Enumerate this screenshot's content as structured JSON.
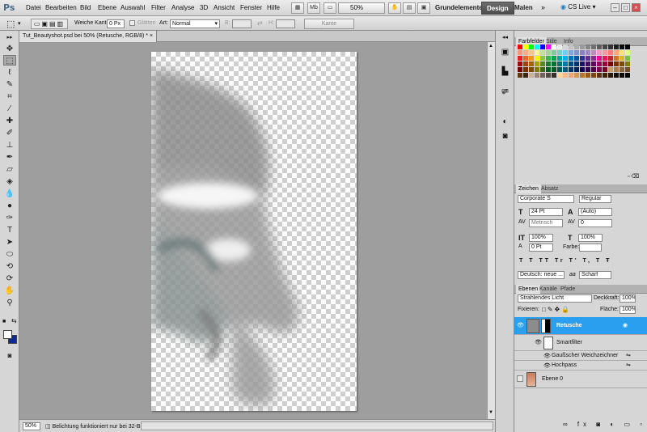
{
  "app": {
    "logo": "Ps"
  },
  "menu": [
    "Datei",
    "Bearbeiten",
    "Bild",
    "Ebene",
    "Auswahl",
    "Filter",
    "Analyse",
    "3D",
    "Ansicht",
    "Fenster",
    "Hilfe"
  ],
  "appbar": {
    "zoom": "50%",
    "workspaces": [
      "Grundelemente",
      "Design",
      "Malen"
    ],
    "cs_live": "CS Live",
    "mb_label": "Mb"
  },
  "options": {
    "soft_edge_label": "Weiche Kante:",
    "soft_edge_value": "0 Px",
    "antialias_label": "Glätten",
    "style_label": "Art:",
    "style_value": "Normal",
    "width_label": "B:",
    "height_label": "H:",
    "refine_button": "Kante verbessern..."
  },
  "document": {
    "tab_title": "Tut_Beautyshot.psd bei 50% (Retusche, RGB/8) *",
    "zoom": "50%",
    "status": "Belichtung funktioniert nur bei 32-Bit"
  },
  "swatch_panel": {
    "tabs": [
      "Farbfelder",
      "Stile",
      "Info"
    ]
  },
  "swatch_colors": [
    [
      "#ff0000",
      "#ffff00",
      "#00ff00",
      "#00ffff",
      "#0000ff",
      "#ff00ff",
      "#ffffff",
      "#ebebeb",
      "#d6d6d6",
      "#c2c2c2",
      "#adadad",
      "#999999",
      "#858585",
      "#707070",
      "#5c5c5c",
      "#474747",
      "#333333",
      "#1f1f1f",
      "#0a0a0a",
      "#000000"
    ],
    [
      "#f7977a",
      "#f9ad81",
      "#fdc68a",
      "#fff79a",
      "#c4df9b",
      "#a2d39c",
      "#82ca9d",
      "#7bcdc8",
      "#6ecff6",
      "#7ea7d8",
      "#8493ca",
      "#8882be",
      "#a187be",
      "#bc8dbf",
      "#f49ac2",
      "#f6989d",
      "#ff7b7b",
      "#ffa77b",
      "#ffe07b",
      "#e0ff7b"
    ],
    [
      "#ed1c24",
      "#f26522",
      "#f7941d",
      "#fff200",
      "#8dc73f",
      "#39b54a",
      "#00a651",
      "#00a99d",
      "#00aeef",
      "#0072bc",
      "#0054a6",
      "#2e3192",
      "#662d91",
      "#92278f",
      "#ec008c",
      "#ed145b",
      "#c1272d",
      "#d4722a",
      "#d9b92a",
      "#7ac142"
    ],
    [
      "#9e0b0f",
      "#a0410d",
      "#a36209",
      "#aba000",
      "#598527",
      "#1a7b30",
      "#007236",
      "#00746b",
      "#0076a3",
      "#004b80",
      "#003471",
      "#1b1464",
      "#440e62",
      "#630460",
      "#9e005d",
      "#9e0039",
      "#790000",
      "#7b2e00",
      "#7d4900",
      "#827b00"
    ],
    [
      "#790000",
      "#7b2e00",
      "#7d4900",
      "#827b00",
      "#406618",
      "#005e20",
      "#005826",
      "#005952",
      "#005b7f",
      "#003663",
      "#002157",
      "#0d004c",
      "#32004b",
      "#4b0049",
      "#7b0046",
      "#7a0026",
      "#c69c6d",
      "#a67c52",
      "#8c6239",
      "#754c24"
    ],
    [
      "#603913",
      "#3c2415",
      "#c7b299",
      "#998675",
      "#736357",
      "#534741",
      "#362f2d",
      "#ffd5a0",
      "#f9ba8a",
      "#e9a77a",
      "#d4955b",
      "#b8752e",
      "#9a5b17",
      "#7d4612",
      "#5e3310",
      "#412407",
      "#2b1704",
      "#140b02",
      "#0a0501",
      "#000000"
    ]
  ],
  "char_panel": {
    "tabs": [
      "Zeichen",
      "Absatz"
    ],
    "font": "Corporate S",
    "style": "Regular",
    "size": "24 Pt",
    "leading": "(Auto)",
    "kerning": "Metrisch",
    "tracking": "0",
    "vscale": "100%",
    "hscale": "100%",
    "baseline": "0 Pt",
    "color_label": "Farbe:",
    "type_buttons": [
      "T",
      "T",
      "TT",
      "Tr",
      "T'",
      "T,",
      "T",
      "Ŧ"
    ],
    "language": "Deutsch: neue ...",
    "aa_label": "aa",
    "antialias": "Scharf"
  },
  "layers_panel": {
    "tabs": [
      "Ebenen",
      "Kanäle",
      "Pfade"
    ],
    "blend_mode": "Strahlendes Licht",
    "opacity_label": "Deckkraft:",
    "opacity": "100%",
    "lock_label": "Fixieren:",
    "fill_label": "Fläche:",
    "fill": "100%",
    "layers": [
      {
        "name": "Retusche",
        "selected": true
      },
      {
        "name": "Smartfilter"
      },
      {
        "name": "Gaußscher Weichzeichner"
      },
      {
        "name": "Hochpass"
      },
      {
        "name": "Ebene 0"
      }
    ]
  }
}
